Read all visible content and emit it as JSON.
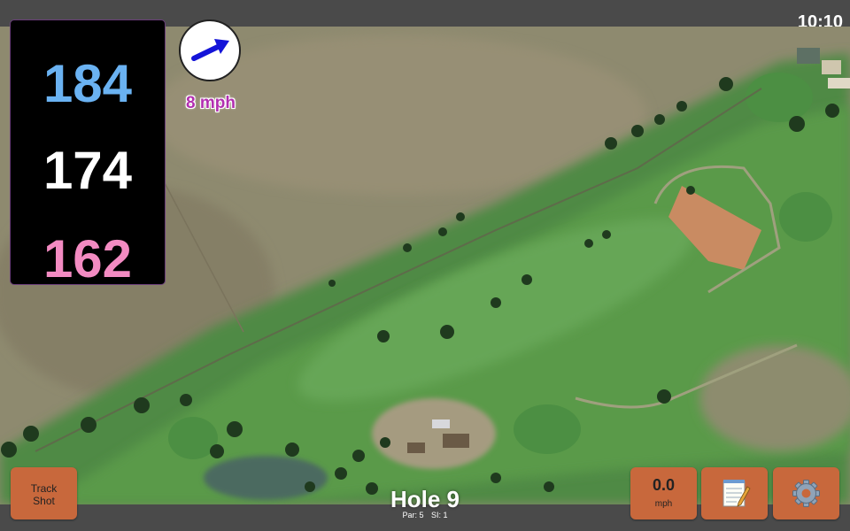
{
  "status": {
    "time": "10:10"
  },
  "distances": {
    "back": "184",
    "middle": "174",
    "front": "162"
  },
  "wind": {
    "speed": "8 mph",
    "direction_icon": "arrow-right-icon"
  },
  "hole": {
    "title": "Hole 9",
    "par": "Par: 5",
    "stroke_index": "SI: 1"
  },
  "buttons": {
    "track_shot": "Track\nShot",
    "track_shot_line1": "Track",
    "track_shot_line2": "Shot",
    "speed_value": "0.0",
    "speed_unit": "mph",
    "notes_icon": "notepad-icon",
    "settings_icon": "gear-icon"
  },
  "colors": {
    "back_distance": "#6ab2f2",
    "middle_distance": "#ffffff",
    "front_distance": "#f38bc2",
    "wind_text": "#b22fb0",
    "button_bg": "#c8683c",
    "bar_bg": "#4a4a4a"
  }
}
